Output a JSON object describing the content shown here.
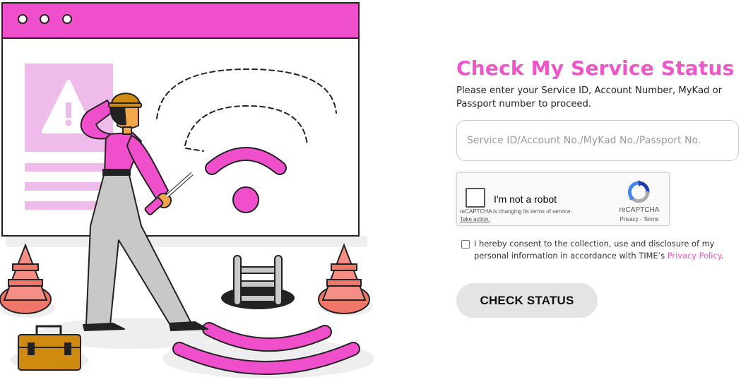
{
  "form": {
    "title": "Check My Service Status",
    "subtitle": "Please enter your Service ID, Account Number, MyKad or Passport number to proceed.",
    "input_placeholder": "Service ID/Account No./MyKad No./Passport No.",
    "input_value": "",
    "consent_prefix": "I hereby consent to the collection, use and disclosure of my personal information in accordance with TIME’s ",
    "consent_link": "Privacy Policy",
    "consent_suffix": ".",
    "consent_checked": false,
    "submit_label": "CHECK STATUS"
  },
  "recaptcha": {
    "label": "I'm not a robot",
    "notice": "reCAPTCHA is changing its terms of service.",
    "notice_link": "Take action.",
    "brand": "reCAPTCHA",
    "legal": "Privacy - Terms",
    "checked": false
  },
  "colors": {
    "accent": "#ef55c8",
    "illustration_pink": "#f04fcb",
    "light_pink": "#efbbea",
    "cone": "#f0766a",
    "toolbox": "#cf8a10",
    "button_bg": "#e4e4e4"
  },
  "illustration": {
    "icons": [
      "browser-window-icon",
      "warning-icon",
      "wifi-icon",
      "worker-icon",
      "screwdriver-icon",
      "traffic-cone-icon",
      "ladder-hole-icon",
      "toolbox-icon"
    ]
  }
}
